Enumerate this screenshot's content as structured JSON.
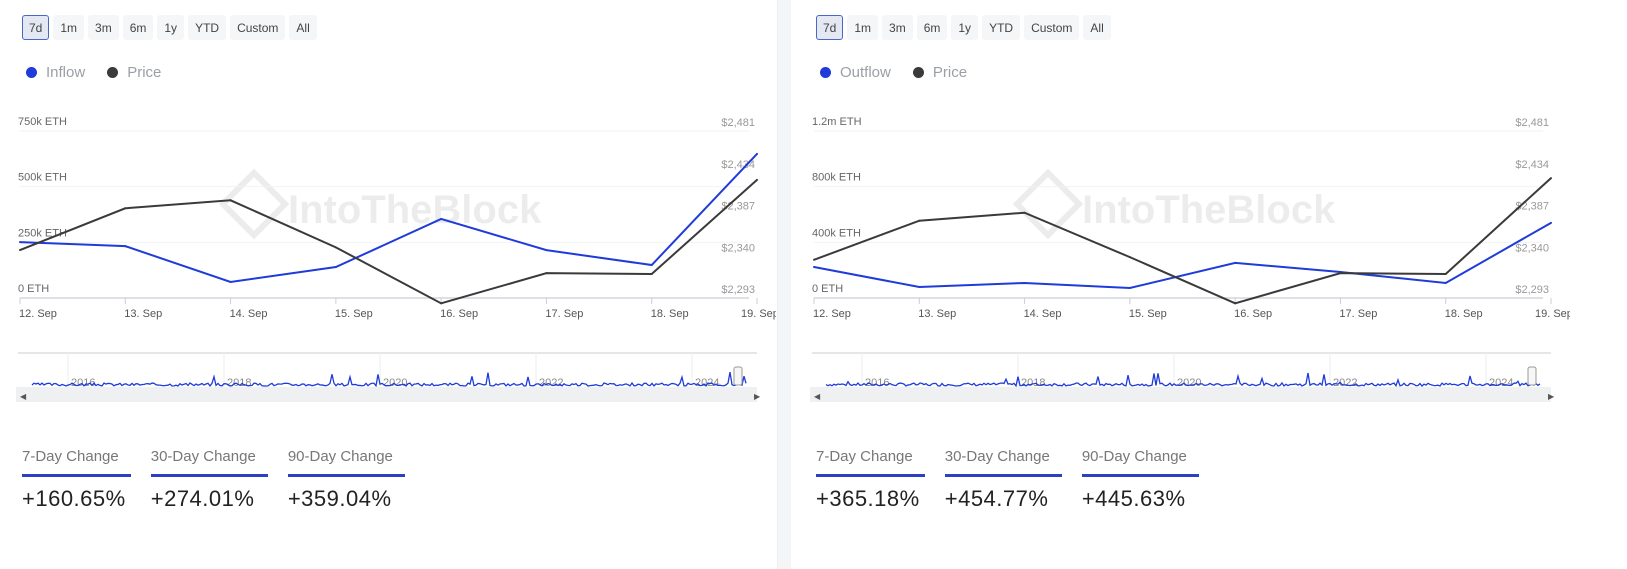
{
  "range_buttons": [
    "7d",
    "1m",
    "3m",
    "6m",
    "1y",
    "YTD",
    "Custom",
    "All"
  ],
  "active_range": "7d",
  "colors": {
    "flow": "#1f3bd9",
    "price": "#3a3a3a",
    "accent": "#2f3fc4"
  },
  "watermark": "IntoTheBlock",
  "navigator_years": [
    "2016",
    "2018",
    "2020",
    "2022",
    "2024"
  ],
  "panels": [
    {
      "legend": [
        "Inflow",
        "Price"
      ],
      "stats": [
        {
          "label": "7-Day Change",
          "value": "+160.65%"
        },
        {
          "label": "30-Day Change",
          "value": "+274.01%"
        },
        {
          "label": "90-Day Change",
          "value": "+359.04%"
        }
      ]
    },
    {
      "legend": [
        "Outflow",
        "Price"
      ],
      "stats": [
        {
          "label": "7-Day Change",
          "value": "+365.18%"
        },
        {
          "label": "30-Day Change",
          "value": "+454.77%"
        },
        {
          "label": "90-Day Change",
          "value": "+445.63%"
        }
      ]
    }
  ],
  "chart_data": [
    {
      "type": "line",
      "categories": [
        "12. Sep",
        "13. Sep",
        "14. Sep",
        "15. Sep",
        "16. Sep",
        "17. Sep",
        "18. Sep",
        "19. Sep"
      ],
      "y_left": {
        "ticks": [
          "0 ETH",
          "250k ETH",
          "500k ETH",
          "750k ETH"
        ],
        "range": [
          0,
          750000
        ]
      },
      "y_right": {
        "ticks": [
          "$2,293",
          "$2,340",
          "$2,387",
          "$2,434",
          "$2,481"
        ],
        "range": [
          2293,
          2481
        ]
      },
      "series": [
        {
          "name": "Inflow",
          "axis": "left",
          "values": [
            251000,
            233000,
            72000,
            139000,
            355000,
            215000,
            148000,
            647000
          ]
        },
        {
          "name": "Price",
          "axis": "right",
          "values": [
            2347,
            2394,
            2403,
            2350,
            2287,
            2321,
            2320,
            2426
          ]
        }
      ],
      "grid": true,
      "legend": "top-left"
    },
    {
      "type": "line",
      "categories": [
        "12. Sep",
        "13. Sep",
        "14. Sep",
        "15. Sep",
        "16. Sep",
        "17. Sep",
        "18. Sep",
        "19. Sep"
      ],
      "y_left": {
        "ticks": [
          "0 ETH",
          "400k ETH",
          "800k ETH",
          "1.2m ETH"
        ],
        "range": [
          0,
          1200000
        ]
      },
      "y_right": {
        "ticks": [
          "$2,293",
          "$2,340",
          "$2,387",
          "$2,434",
          "$2,481"
        ],
        "range": [
          2293,
          2481
        ]
      },
      "series": [
        {
          "name": "Outflow",
          "axis": "left",
          "values": [
            223000,
            79000,
            108000,
            72000,
            252000,
            187000,
            108000,
            540000
          ]
        },
        {
          "name": "Price",
          "axis": "right",
          "values": [
            2336,
            2380,
            2389,
            2339,
            2287,
            2321,
            2320,
            2428
          ]
        }
      ],
      "grid": true,
      "legend": "top-left"
    }
  ]
}
